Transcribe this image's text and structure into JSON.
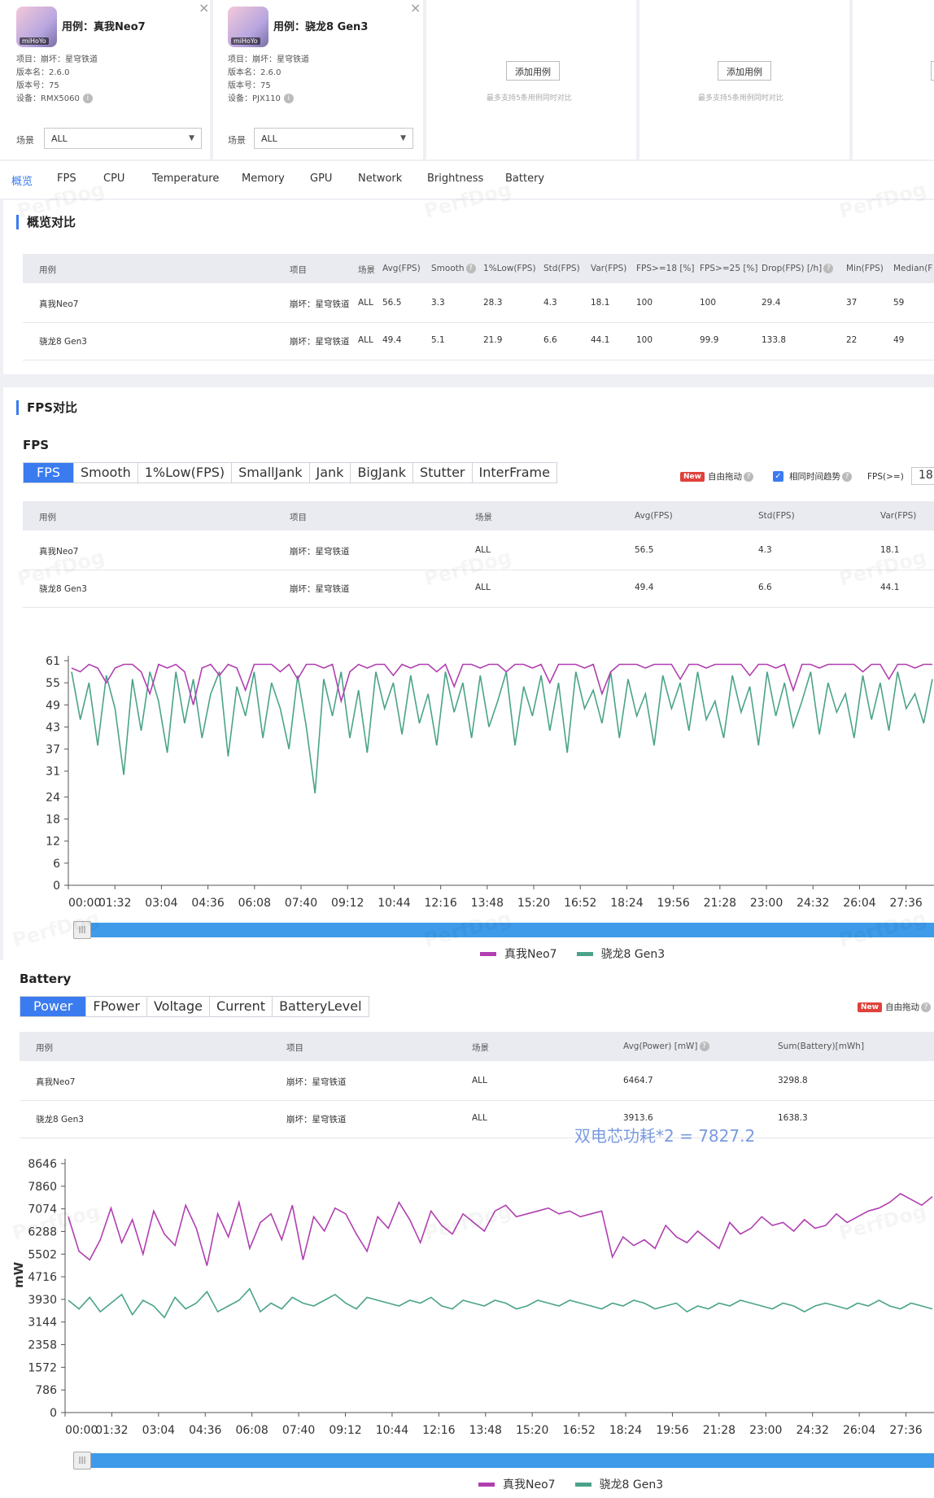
{
  "cases": [
    {
      "title": "用例：真我Neo7",
      "avatar_tag": "miHoYo",
      "project": "项目：崩坏：星穹铁道",
      "version_name": "版本名：2.6.0",
      "version_code": "版本号：75",
      "device": "设备：RMX5060",
      "scene_label": "场景",
      "scene_value": "ALL"
    },
    {
      "title": "用例：骁龙8 Gen3",
      "avatar_tag": "miHoYo",
      "project": "项目：崩坏：星穹铁道",
      "version_name": "版本名：2.6.0",
      "version_code": "版本号：75",
      "device": "设备：PJX110",
      "scene_label": "场景",
      "scene_value": "ALL"
    }
  ],
  "add_slots": [
    {
      "label": "添加用例",
      "hint": "最多支持5条用例同时对比"
    },
    {
      "label": "添加用例",
      "hint": "最多支持5条用例同时对比"
    }
  ],
  "tabs": [
    "概览",
    "FPS",
    "CPU",
    "Temperature",
    "Memory",
    "GPU",
    "Network",
    "Brightness",
    "Battery"
  ],
  "overview": {
    "title": "概览对比",
    "headers": [
      "用例",
      "项目",
      "场景",
      "Avg(FPS)",
      "Smooth",
      "1%Low(FPS)",
      "Std(FPS)",
      "Var(FPS)",
      "FPS>=18 [%]",
      "FPS>=25 [%]",
      "Drop(FPS) [/h]",
      "Min(FPS)",
      "Median(F"
    ],
    "rows": [
      [
        "真我Neo7",
        "崩坏：星穹铁道",
        "ALL",
        "56.5",
        "3.3",
        "28.3",
        "4.3",
        "18.1",
        "100",
        "100",
        "29.4",
        "37",
        "59"
      ],
      [
        "骁龙8 Gen3",
        "崩坏：星穹铁道",
        "ALL",
        "49.4",
        "5.1",
        "21.9",
        "6.6",
        "44.1",
        "100",
        "99.9",
        "133.8",
        "22",
        "49"
      ]
    ]
  },
  "fps_section": {
    "title": "FPS对比",
    "subtitle": "FPS",
    "segments": [
      "FPS",
      "Smooth",
      "1%Low(FPS)",
      "SmallJank",
      "Jank",
      "BigJank",
      "Stutter",
      "InterFrame"
    ],
    "new_badge": "New",
    "free_drag": "自由拖动",
    "same_time": "相同时间趋势",
    "fps_ge_label": "FPS(>=)",
    "fps_ge_value": "18",
    "headers": [
      "用例",
      "项目",
      "场景",
      "Avg(FPS)",
      "Std(FPS)",
      "Var(FPS)"
    ],
    "rows": [
      [
        "真我Neo7",
        "崩坏：星穹铁道",
        "ALL",
        "56.5",
        "4.3",
        "18.1"
      ],
      [
        "骁龙8 Gen3",
        "崩坏：星穹铁道",
        "ALL",
        "49.4",
        "6.6",
        "44.1"
      ]
    ]
  },
  "battery_section": {
    "subtitle": "Battery",
    "segments": [
      "Power",
      "FPower",
      "Voltage",
      "Current",
      "BatteryLevel"
    ],
    "new_badge": "New",
    "free_drag": "自由拖动",
    "headers": [
      "用例",
      "项目",
      "场景",
      "Avg(Power) [mW]",
      "Sum(Battery)[mWh]"
    ],
    "rows": [
      [
        "真我Neo7",
        "崩坏：星穹铁道",
        "ALL",
        "6464.7",
        "3298.8"
      ],
      [
        "骁龙8 Gen3",
        "崩坏：星穹铁道",
        "ALL",
        "3913.6",
        "1638.3"
      ]
    ],
    "annotation": "双电芯功耗*2 = 7827.2"
  },
  "watermark": "PerfDog",
  "colors": {
    "accent": "#3a7bf0",
    "series_a": "#b03fb0",
    "series_b": "#4aa38a"
  },
  "chart_data": [
    {
      "type": "line",
      "xlabel": "",
      "ylabel": "",
      "yticks": [
        0,
        6,
        12,
        18,
        24,
        31,
        37,
        43,
        49,
        55,
        61
      ],
      "ylim": [
        0,
        61
      ],
      "xticks": [
        "00:00",
        "01:32",
        "03:04",
        "04:36",
        "06:08",
        "07:40",
        "09:12",
        "10:44",
        "12:16",
        "13:48",
        "15:20",
        "16:52",
        "18:24",
        "19:56",
        "21:28",
        "23:00",
        "24:32",
        "26:04",
        "27:36"
      ],
      "series": [
        {
          "name": "真我Neo7",
          "values": [
            59,
            58,
            60,
            59,
            55,
            59,
            60,
            60,
            58,
            52,
            60,
            59,
            60,
            58,
            49,
            59,
            60,
            57,
            60,
            59,
            53,
            60,
            60,
            60,
            58,
            60,
            56,
            60,
            60,
            59,
            60,
            50,
            58,
            60,
            59,
            60,
            60,
            57,
            60,
            59,
            60,
            60,
            58,
            60,
            54,
            60,
            60,
            59,
            60,
            60,
            58,
            60,
            60,
            59,
            60,
            55,
            60,
            60,
            60,
            59,
            60,
            52,
            58,
            60,
            60,
            60,
            59,
            60,
            60,
            60,
            56,
            60,
            60,
            59,
            60,
            60,
            60,
            60,
            57,
            60,
            60,
            59,
            60,
            53,
            60,
            60,
            59,
            60,
            60,
            60,
            60,
            58,
            60,
            60,
            56,
            60,
            60,
            59,
            60,
            60
          ]
        },
        {
          "name": "骁龙8 Gen3",
          "values": [
            58,
            45,
            55,
            38,
            57,
            48,
            30,
            56,
            42,
            58,
            50,
            36,
            58,
            44,
            56,
            40,
            52,
            58,
            35,
            54,
            46,
            58,
            40,
            55,
            48,
            37,
            57,
            43,
            25,
            56,
            46,
            58,
            40,
            53,
            36,
            58,
            48,
            55,
            41,
            57,
            44,
            52,
            38,
            58,
            47,
            55,
            40,
            57,
            43,
            50,
            58,
            38,
            54,
            46,
            57,
            42,
            55,
            36,
            58,
            48,
            53,
            44,
            58,
            40,
            56,
            46,
            52,
            38,
            57,
            48,
            55,
            42,
            58,
            45,
            50,
            40,
            57,
            47,
            54,
            38,
            58,
            46,
            55,
            43,
            50,
            58,
            41,
            55,
            47,
            52,
            40,
            57,
            45,
            55,
            42,
            58,
            48,
            52,
            44,
            56
          ]
        }
      ]
    },
    {
      "type": "line",
      "xlabel": "",
      "ylabel": "mW",
      "yticks": [
        0,
        786,
        1572,
        2358,
        3144,
        3930,
        4716,
        5502,
        6288,
        7074,
        7860,
        8646
      ],
      "ylim": [
        0,
        8646
      ],
      "xticks": [
        "00:00",
        "01:32",
        "03:04",
        "04:36",
        "06:08",
        "07:40",
        "09:12",
        "10:44",
        "12:16",
        "13:48",
        "15:20",
        "16:52",
        "18:24",
        "19:56",
        "21:28",
        "23:00",
        "24:32",
        "26:04",
        "27:36"
      ],
      "series": [
        {
          "name": "真我Neo7",
          "values": [
            6800,
            5600,
            5300,
            6000,
            7100,
            5900,
            6700,
            5500,
            7000,
            6200,
            5800,
            7200,
            6400,
            5100,
            6900,
            6100,
            7300,
            5700,
            6600,
            6900,
            6000,
            7200,
            5300,
            6800,
            6300,
            7100,
            6900,
            6200,
            5600,
            6800,
            6400,
            7300,
            6700,
            5900,
            7000,
            6500,
            6200,
            6900,
            6600,
            6300,
            7000,
            7200,
            6800,
            6900,
            7000,
            7100,
            6900,
            7000,
            6800,
            6900,
            7000,
            5400,
            6100,
            5800,
            6000,
            5700,
            6500,
            6100,
            5900,
            6300,
            6000,
            5700,
            6600,
            6200,
            6400,
            6800,
            6500,
            6600,
            6300,
            6700,
            6400,
            6500,
            6900,
            6600,
            6800,
            7000,
            7100,
            7300,
            7600,
            7400,
            7200,
            7500
          ]
        },
        {
          "name": "骁龙8 Gen3",
          "values": [
            3900,
            3600,
            4000,
            3500,
            3800,
            4100,
            3400,
            3900,
            3700,
            3300,
            4000,
            3600,
            3800,
            4200,
            3500,
            3700,
            3900,
            4300,
            3500,
            3800,
            3600,
            4000,
            3800,
            3700,
            3900,
            4100,
            3800,
            3600,
            4000,
            3900,
            3800,
            3700,
            3900,
            3800,
            4000,
            3700,
            3600,
            3900,
            3800,
            3700,
            3900,
            3800,
            3600,
            3700,
            3900,
            3800,
            3700,
            3900,
            3800,
            3700,
            3600,
            3800,
            3700,
            3900,
            3800,
            3600,
            3700,
            3800,
            3500,
            3700,
            3600,
            3800,
            3700,
            3900,
            3800,
            3700,
            3600,
            3800,
            3700,
            3500,
            3700,
            3800,
            3700,
            3600,
            3800,
            3700,
            3900,
            3700,
            3600,
            3800,
            3700,
            3600
          ]
        }
      ]
    }
  ]
}
